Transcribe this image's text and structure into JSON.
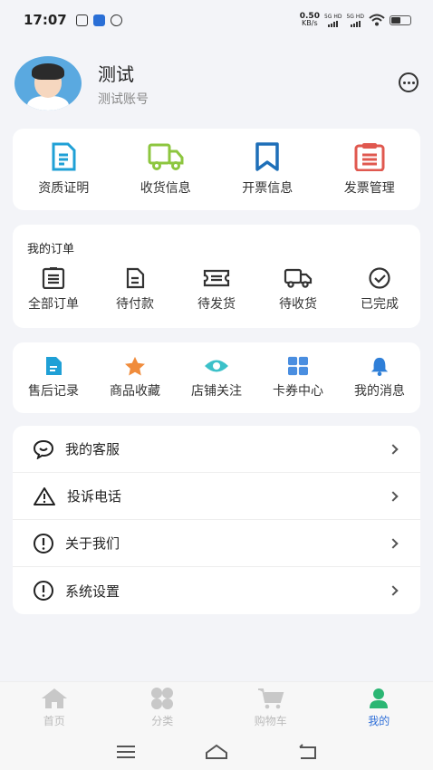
{
  "status": {
    "time": "17:07",
    "net_speed": "0.50",
    "net_unit": "KB/s",
    "sig1": "5G HD",
    "sig2": "5G HD"
  },
  "profile": {
    "name": "测试",
    "account": "测试账号"
  },
  "quick": [
    {
      "label": "资质证明",
      "icon": "document-icon",
      "color": "#1fa0d6"
    },
    {
      "label": "收货信息",
      "icon": "truck-icon",
      "color": "#8dc63f"
    },
    {
      "label": "开票信息",
      "icon": "bookmark-icon",
      "color": "#1e6fb8"
    },
    {
      "label": "发票管理",
      "icon": "clipboard-icon",
      "color": "#e0584f"
    }
  ],
  "orders": {
    "title": "我的订单",
    "items": [
      {
        "label": "全部订单",
        "icon": "list-icon"
      },
      {
        "label": "待付款",
        "icon": "bill-icon"
      },
      {
        "label": "待发货",
        "icon": "ticket-icon"
      },
      {
        "label": "待收货",
        "icon": "truck-icon"
      },
      {
        "label": "已完成",
        "icon": "check-circle-icon"
      }
    ]
  },
  "tools": [
    {
      "label": "售后记录",
      "icon": "file-icon",
      "color": "#1fa0d6"
    },
    {
      "label": "商品收藏",
      "icon": "star-icon",
      "color": "#f08c3c"
    },
    {
      "label": "店铺关注",
      "icon": "eye-icon",
      "color": "#3cc1c9"
    },
    {
      "label": "卡券中心",
      "icon": "grid-icon",
      "color": "#4a8ee0"
    },
    {
      "label": "我的消息",
      "icon": "bell-icon",
      "color": "#2f7fd8"
    }
  ],
  "menu": [
    {
      "label": "我的客服",
      "icon": "chat-icon"
    },
    {
      "label": "投诉电话",
      "icon": "warning-icon"
    },
    {
      "label": "关于我们",
      "icon": "info-icon"
    },
    {
      "label": "系统设置",
      "icon": "info-icon"
    }
  ],
  "tabs": [
    {
      "label": "首页",
      "icon": "home-icon"
    },
    {
      "label": "分类",
      "icon": "category-icon"
    },
    {
      "label": "购物车",
      "icon": "cart-icon"
    },
    {
      "label": "我的",
      "icon": "user-icon",
      "active": true
    }
  ],
  "colors": {
    "accent": "#2f6fd8",
    "active_tab_icon": "#2bb673"
  }
}
